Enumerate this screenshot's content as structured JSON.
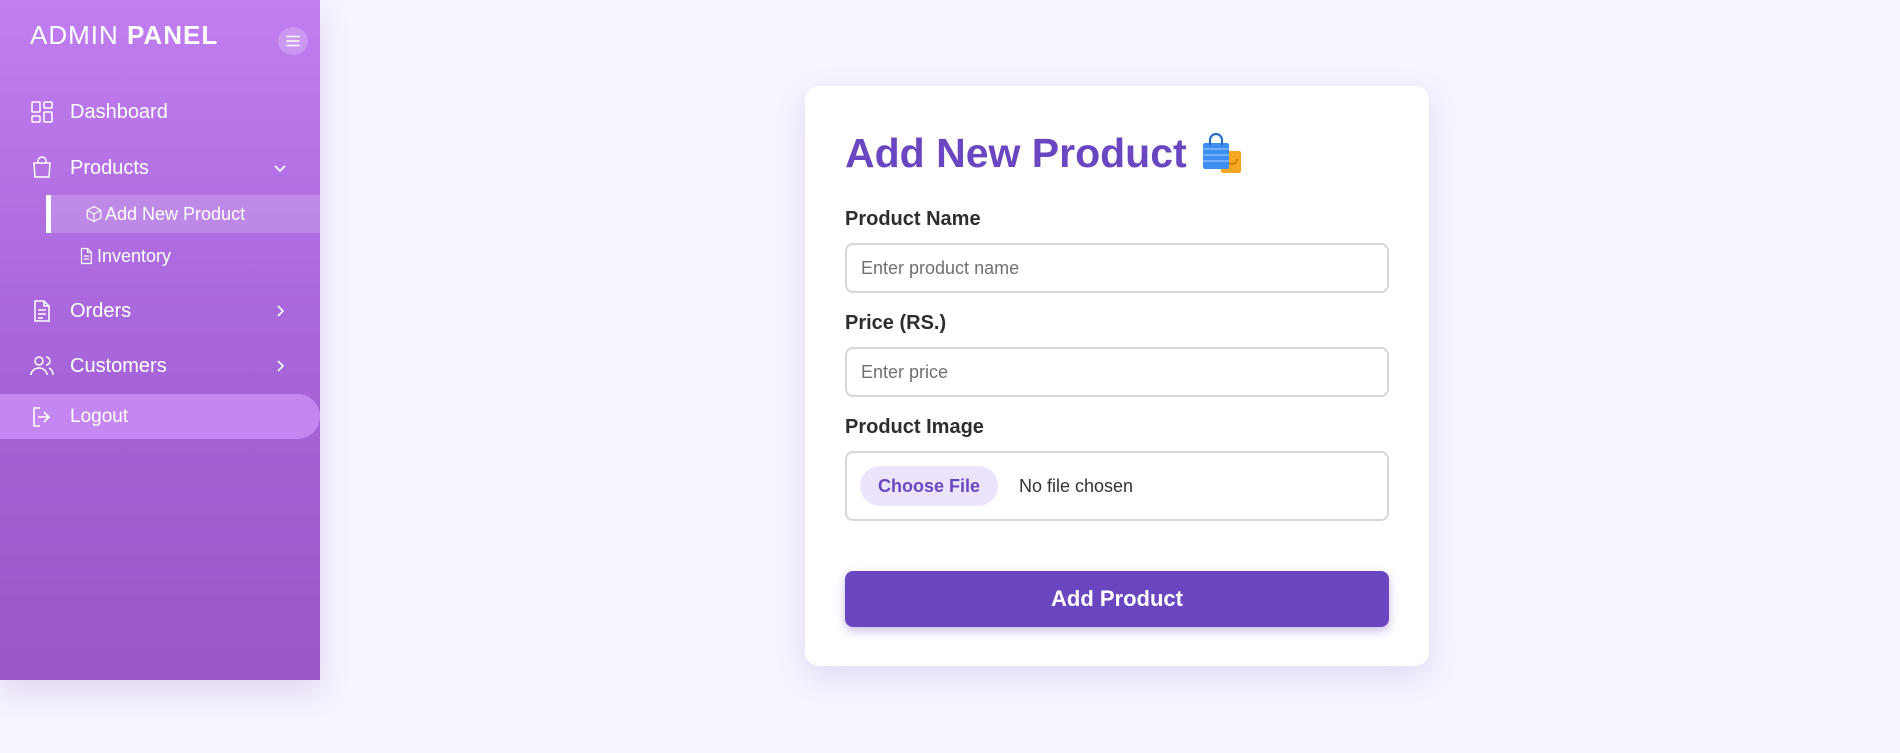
{
  "sidebar": {
    "brand_light": "ADMIN",
    "brand_bold": "PANEL",
    "items": [
      {
        "label": "Dashboard",
        "icon": "dashboard-grid-icon"
      },
      {
        "label": "Products",
        "icon": "shopping-bag-icon",
        "expanded": true,
        "children": [
          {
            "label": "Add New Product",
            "icon": "box-icon",
            "active": true
          },
          {
            "label": "Inventory",
            "icon": "document-icon"
          }
        ]
      },
      {
        "label": "Orders",
        "icon": "document-icon"
      },
      {
        "label": "Customers",
        "icon": "users-icon"
      }
    ],
    "logout": {
      "label": "Logout",
      "icon": "logout-icon"
    }
  },
  "form": {
    "title": "Add New Product",
    "title_icon": "shopping-bags-emoji-icon",
    "name_label": "Product Name",
    "name_placeholder": "Enter product name",
    "price_label": "Price (RS.)",
    "price_placeholder": "Enter price",
    "image_label": "Product Image",
    "file_button": "Choose File",
    "file_status": "No file chosen",
    "submit": "Add Product"
  },
  "colors": {
    "accent": "#6b46c1",
    "sidebar_top": "#c17ef0",
    "sidebar_bottom": "#9a55c8",
    "background": "#f7f4fe"
  }
}
